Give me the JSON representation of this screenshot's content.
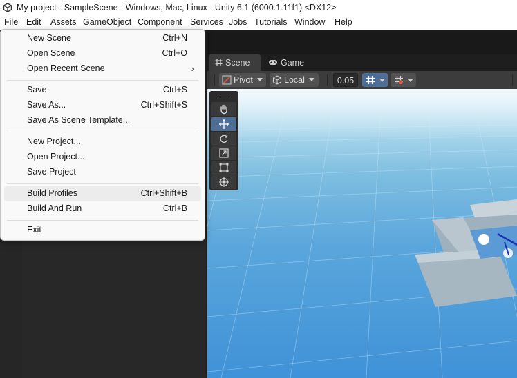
{
  "window": {
    "title": "My project - SampleScene - Windows, Mac, Linux - Unity 6.1 (6000.1.11f1) <DX12>"
  },
  "menubar": {
    "items": [
      "File",
      "Edit",
      "Assets",
      "GameObject",
      "Component",
      "Services",
      "Jobs",
      "Tutorials",
      "Window",
      "Help"
    ]
  },
  "file_menu": {
    "new_scene": {
      "label": "New Scene",
      "shortcut": "Ctrl+N"
    },
    "open_scene": {
      "label": "Open Scene",
      "shortcut": "Ctrl+O"
    },
    "open_recent_scene": {
      "label": "Open Recent Scene"
    },
    "save": {
      "label": "Save",
      "shortcut": "Ctrl+S"
    },
    "save_as": {
      "label": "Save As...",
      "shortcut": "Ctrl+Shift+S"
    },
    "save_as_template": {
      "label": "Save As Scene Template..."
    },
    "new_project": {
      "label": "New Project..."
    },
    "open_project": {
      "label": "Open Project..."
    },
    "save_project": {
      "label": "Save Project"
    },
    "build_profiles": {
      "label": "Build Profiles",
      "shortcut": "Ctrl+Shift+B"
    },
    "build_and_run": {
      "label": "Build And Run",
      "shortcut": "Ctrl+B"
    },
    "exit": {
      "label": "Exit"
    },
    "highlighted_item": "Build Profiles"
  },
  "tabs": {
    "scene": "Scene",
    "game": "Game",
    "active": "Scene"
  },
  "scene_toolbar": {
    "pivot": "Pivot",
    "space": "Local",
    "grid_snap_value": "0.05"
  },
  "tools": {
    "active": "move-tool",
    "items": [
      "hand-tool",
      "move-tool",
      "rotate-tool",
      "scale-tool",
      "rect-tool",
      "transform-tool"
    ]
  },
  "colors": {
    "menu_bg": "#f9f9f9",
    "menu_highlight": "#ececec",
    "editor_dark": "#282828",
    "toolbar": "#3c3c3c",
    "active_tool": "#4f6e96",
    "sky_top": "#e6f4fb",
    "ground_blue": "#3f92d8"
  }
}
